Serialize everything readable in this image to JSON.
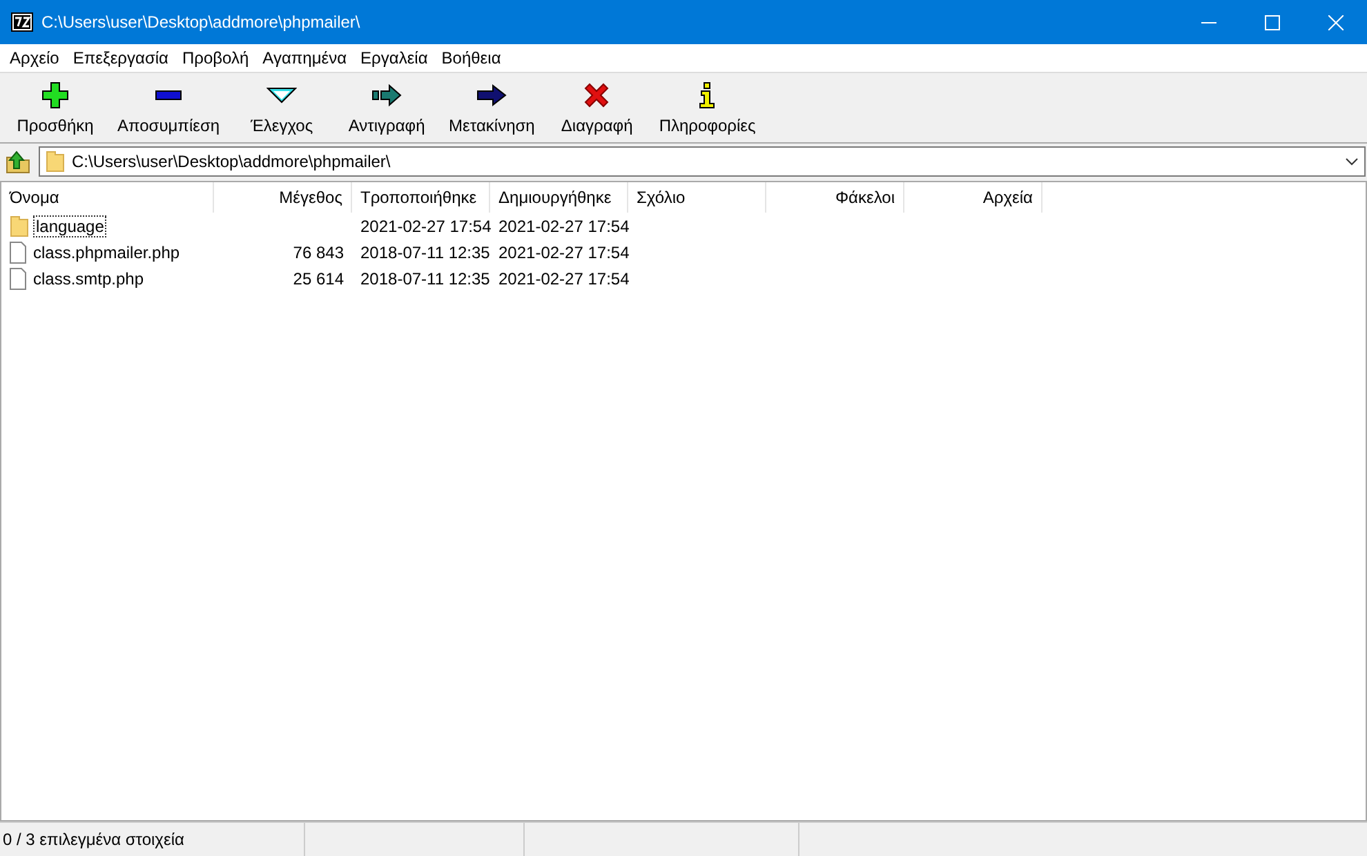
{
  "window": {
    "title": "C:\\Users\\user\\Desktop\\addmore\\phpmailer\\"
  },
  "menu": [
    "Αρχείο",
    "Επεξεργασία",
    "Προβολή",
    "Αγαπημένα",
    "Εργαλεία",
    "Βοήθεια"
  ],
  "toolbar": [
    {
      "kind": "add",
      "label": "Προσθήκη"
    },
    {
      "kind": "extract",
      "label": "Αποσυμπίεση"
    },
    {
      "kind": "test",
      "label": "Έλεγχος"
    },
    {
      "kind": "copy",
      "label": "Αντιγραφή"
    },
    {
      "kind": "move",
      "label": "Μετακίνηση"
    },
    {
      "kind": "delete",
      "label": "Διαγραφή"
    },
    {
      "kind": "info",
      "label": "Πληροφορίες"
    }
  ],
  "address": {
    "value": "C:\\Users\\user\\Desktop\\addmore\\phpmailer\\"
  },
  "table": {
    "columns": [
      "Όνομα",
      "Μέγεθος",
      "Τροποποιήθηκε",
      "Δημιουργήθηκε",
      "Σχόλιο",
      "Φάκελοι",
      "Αρχεία"
    ],
    "rows": [
      {
        "kind": "folder",
        "focused": true,
        "cells": [
          "language",
          "",
          "2021-02-27 17:54",
          "2021-02-27 17:54",
          "",
          "",
          ""
        ]
      },
      {
        "kind": "file",
        "focused": false,
        "cells": [
          "class.phpmailer.php",
          "76 843",
          "2018-07-11 12:35",
          "2021-02-27 17:54",
          "",
          "",
          ""
        ]
      },
      {
        "kind": "file",
        "focused": false,
        "cells": [
          "class.smtp.php",
          "25 614",
          "2018-07-11 12:35",
          "2021-02-27 17:54",
          "",
          "",
          ""
        ]
      }
    ]
  },
  "status_bar": [
    "0 / 3 επιλεγμένα στοιχεία"
  ]
}
